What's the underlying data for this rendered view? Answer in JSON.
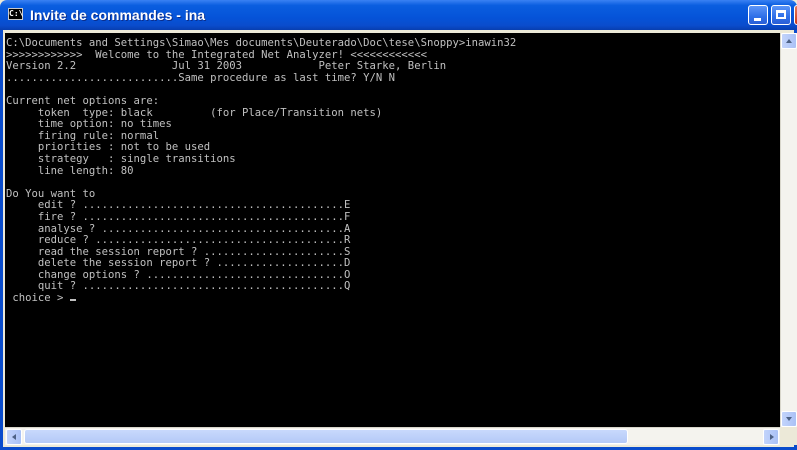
{
  "window": {
    "title": "Invite de commandes - ina",
    "icon_text": "C:\\"
  },
  "console": {
    "lines": [
      "C:\\Documents and Settings\\Simao\\Mes documents\\Deuterado\\Doc\\tese\\Snoppy>inawin32",
      ">>>>>>>>>>>>  Welcome to the Integrated Net Analyzer! <<<<<<<<<<<<",
      "Version 2.2               Jul 31 2003            Peter Starke, Berlin",
      "...........................Same procedure as last time? Y/N N",
      "",
      "Current net options are:",
      "     token  type: black         (for Place/Transition nets)",
      "     time option: no times",
      "     firing rule: normal",
      "     priorities : not to be used",
      "     strategy   : single transitions",
      "     line length: 80",
      "",
      "Do You want to",
      "     edit ? .........................................E",
      "     fire ? .........................................F",
      "     analyse ? ......................................A",
      "     reduce ? .......................................R",
      "     read the session report ? ......................S",
      "     delete the session report ? ....................D",
      "     change options ? ...............................O",
      "     quit ? .........................................Q"
    ],
    "prompt": " choice > "
  },
  "colors": {
    "titlebar": "#0553d8",
    "console_bg": "#000000",
    "console_fg": "#c0c0c0"
  },
  "icons": {
    "app": "console-icon",
    "minimize": "minimize-icon",
    "maximize": "maximize-icon",
    "close": "close-icon"
  }
}
